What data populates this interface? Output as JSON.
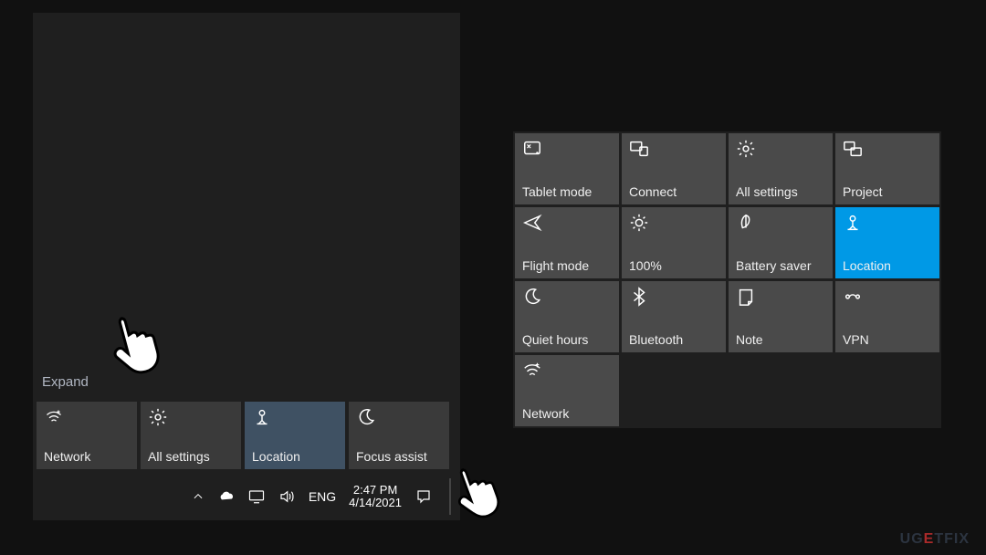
{
  "action_center": {
    "expand_label": "Expand",
    "tiles": [
      {
        "id": "network",
        "label": "Network",
        "icon": "wifi",
        "active": false
      },
      {
        "id": "all-settings",
        "label": "All settings",
        "icon": "gear",
        "active": false
      },
      {
        "id": "location",
        "label": "Location",
        "icon": "location",
        "active": true
      },
      {
        "id": "focus-assist",
        "label": "Focus assist",
        "icon": "moon",
        "active": false
      }
    ]
  },
  "taskbar": {
    "lang": "ENG",
    "time": "2:47 PM",
    "date": "4/14/2021"
  },
  "expanded_panel": {
    "tiles": [
      {
        "id": "tablet-mode",
        "label": "Tablet mode",
        "icon": "tablet",
        "active": false
      },
      {
        "id": "connect",
        "label": "Connect",
        "icon": "connect",
        "active": false
      },
      {
        "id": "all-settings",
        "label": "All settings",
        "icon": "gear",
        "active": false
      },
      {
        "id": "project",
        "label": "Project",
        "icon": "project",
        "active": false
      },
      {
        "id": "flight-mode",
        "label": "Flight mode",
        "icon": "airplane",
        "active": false
      },
      {
        "id": "brightness",
        "label": "100%",
        "icon": "sun",
        "active": false
      },
      {
        "id": "battery-saver",
        "label": "Battery saver",
        "icon": "leaf",
        "active": false
      },
      {
        "id": "location",
        "label": "Location",
        "icon": "location",
        "active": true
      },
      {
        "id": "quiet-hours",
        "label": "Quiet hours",
        "icon": "moon",
        "active": false
      },
      {
        "id": "bluetooth",
        "label": "Bluetooth",
        "icon": "bluetooth",
        "active": false
      },
      {
        "id": "note",
        "label": "Note",
        "icon": "note",
        "active": false
      },
      {
        "id": "vpn",
        "label": "VPN",
        "icon": "vpn",
        "active": false
      },
      {
        "id": "network",
        "label": "Network",
        "icon": "wifi",
        "active": false
      }
    ]
  },
  "watermark": {
    "text_pre": "UG",
    "text_mid": "E",
    "text_post": "TFIX"
  }
}
